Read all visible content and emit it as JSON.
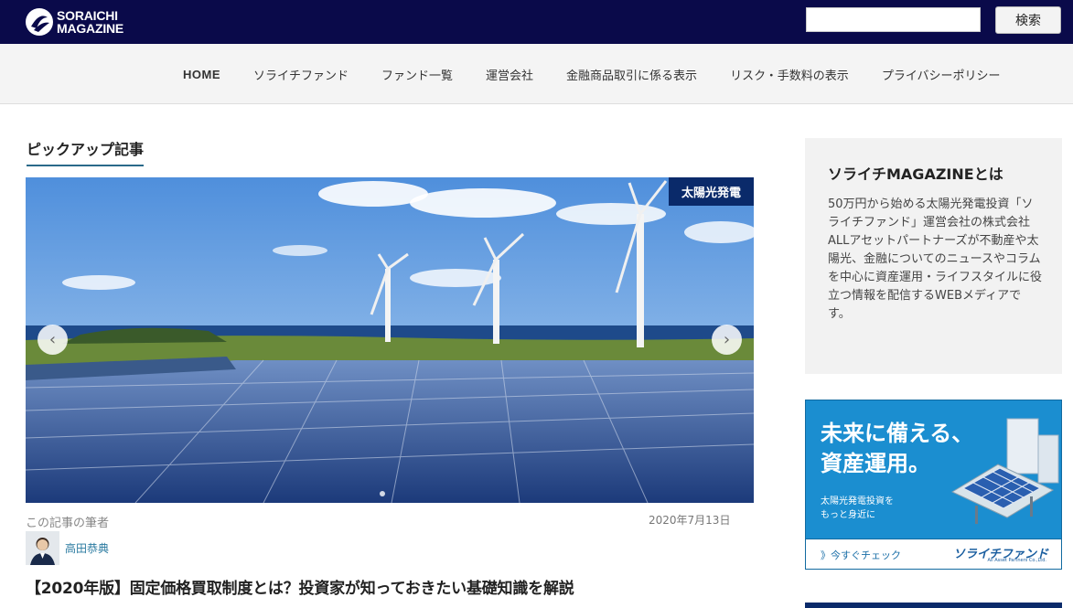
{
  "brand": {
    "logo_line1": "SORAICHI",
    "logo_line2": "MAGAZINE"
  },
  "search": {
    "placeholder": "",
    "button_label": "検索"
  },
  "nav": {
    "items": [
      "HOME",
      "ソライチファンド",
      "ファンド一覧",
      "運営会社",
      "金融商品取引に係る表示",
      "リスク・手数料の表示",
      "プライバシーポリシー"
    ]
  },
  "pickup": {
    "heading": "ピックアップ記事",
    "category": "太陽光発電",
    "author_label": "この記事の筆者",
    "author_name": "高田恭典",
    "date": "2020年7月13日",
    "title": "【2020年版】固定価格買取制度とは？投資家が知っておきたい基礎知識を解説"
  },
  "sidebar": {
    "about_title": "ソライチMAGAZINEとは",
    "about_text": "50万円から始める太陽光発電投資「ソライチファンド」運営会社の株式会社ALLアセットパートナーズが不動産や太陽光、金融についてのニュースやコラムを中心に資産運用・ライフスタイルに役立つ情報を配信するWEBメディアです。"
  },
  "banner": {
    "headline1": "未来に備える、",
    "headline2": "資産運用。",
    "sub1": "太陽光発電投資を",
    "sub2": "もっと身近に",
    "cta": "》今すぐチェック",
    "brand": "ソライチファンド",
    "brand_sub": "All Asset Partners Co.,Ltd."
  },
  "colors": {
    "topbar": "#0a0a4a",
    "accent": "#2a6a8a",
    "banner": "#1b8ed0"
  }
}
